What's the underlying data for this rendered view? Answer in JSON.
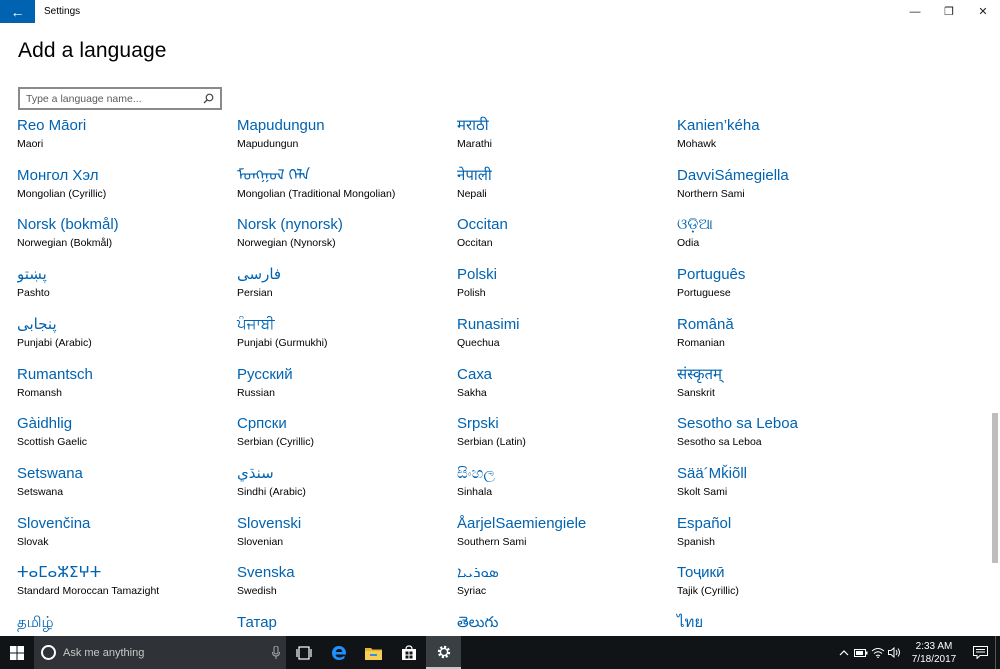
{
  "window": {
    "title": "Settings",
    "back_glyph": "←",
    "minimize_glyph": "—",
    "restore_glyph": "❐",
    "close_glyph": "✕"
  },
  "page": {
    "title": "Add a language"
  },
  "search": {
    "placeholder": "Type a language name...",
    "value": ""
  },
  "colors": {
    "accent": "#0063b1",
    "taskbar": "#101417"
  },
  "languages": [
    {
      "native": "Reo Māori",
      "english": "Maori"
    },
    {
      "native": "Mapudungun",
      "english": "Mapudungun"
    },
    {
      "native": "मराठी",
      "english": "Marathi"
    },
    {
      "native": "Kanien’kéha",
      "english": "Mohawk"
    },
    {
      "native": "Монгол Хэл",
      "english": "Mongolian (Cyrillic)"
    },
    {
      "native": "ᠮᠣᠩᠭᠣᠯ ᠬᠡᠯᠡ",
      "english": "Mongolian (Traditional Mongolian)"
    },
    {
      "native": "नेपाली",
      "english": "Nepali"
    },
    {
      "native": "DavviSámegiella",
      "english": "Northern Sami"
    },
    {
      "native": "Norsk (bokmål)",
      "english": "Norwegian (Bokmål)"
    },
    {
      "native": "Norsk (nynorsk)",
      "english": "Norwegian (Nynorsk)"
    },
    {
      "native": "Occitan",
      "english": "Occitan"
    },
    {
      "native": "ଓଡ଼ିଆ",
      "english": "Odia"
    },
    {
      "native": "پښتو",
      "english": "Pashto"
    },
    {
      "native": "فارسی",
      "english": "Persian"
    },
    {
      "native": "Polski",
      "english": "Polish"
    },
    {
      "native": "Português",
      "english": "Portuguese"
    },
    {
      "native": "پنجابی",
      "english": "Punjabi (Arabic)"
    },
    {
      "native": "ਪੰਜਾਬੀ",
      "english": "Punjabi (Gurmukhi)"
    },
    {
      "native": "Runasimi",
      "english": "Quechua"
    },
    {
      "native": "Română",
      "english": "Romanian"
    },
    {
      "native": "Rumantsch",
      "english": "Romansh"
    },
    {
      "native": "Русский",
      "english": "Russian"
    },
    {
      "native": "Саха",
      "english": "Sakha"
    },
    {
      "native": "संस्कृतम्",
      "english": "Sanskrit"
    },
    {
      "native": "Gàidhlig",
      "english": "Scottish Gaelic"
    },
    {
      "native": "Српски",
      "english": "Serbian (Cyrillic)"
    },
    {
      "native": "Srpski",
      "english": "Serbian (Latin)"
    },
    {
      "native": "Sesotho sa Leboa",
      "english": "Sesotho sa Leboa"
    },
    {
      "native": "Setswana",
      "english": "Setswana"
    },
    {
      "native": "سنڌي",
      "english": "Sindhi (Arabic)"
    },
    {
      "native": "සිංහල",
      "english": "Sinhala"
    },
    {
      "native": "Sää´Mǩiõll",
      "english": "Skolt Sami"
    },
    {
      "native": "Slovenčina",
      "english": "Slovak"
    },
    {
      "native": "Slovenski",
      "english": "Slovenian"
    },
    {
      "native": "ÅarjelSaemiengiele",
      "english": "Southern Sami"
    },
    {
      "native": "Español",
      "english": "Spanish"
    },
    {
      "native": "ⵜⴰⵎⴰⵣⵉⵖⵜ",
      "english": "Standard Moroccan Tamazight"
    },
    {
      "native": "Svenska",
      "english": "Swedish"
    },
    {
      "native": "ܣܘܪܝܝܐ",
      "english": "Syriac"
    },
    {
      "native": "Тоҷикӣ",
      "english": "Tajik (Cyrillic)"
    },
    {
      "native": "தமிழ்",
      "english": ""
    },
    {
      "native": "Татар",
      "english": ""
    },
    {
      "native": "తెలుగు",
      "english": ""
    },
    {
      "native": "ไทย",
      "english": ""
    }
  ],
  "taskbar": {
    "search_placeholder": "Ask me anything",
    "time": "2:33 AM",
    "date": "7/18/2017",
    "icons": [
      "windows-start-icon",
      "task-view-icon",
      "edge-icon",
      "file-explorer-icon",
      "store-icon",
      "settings-icon"
    ]
  }
}
